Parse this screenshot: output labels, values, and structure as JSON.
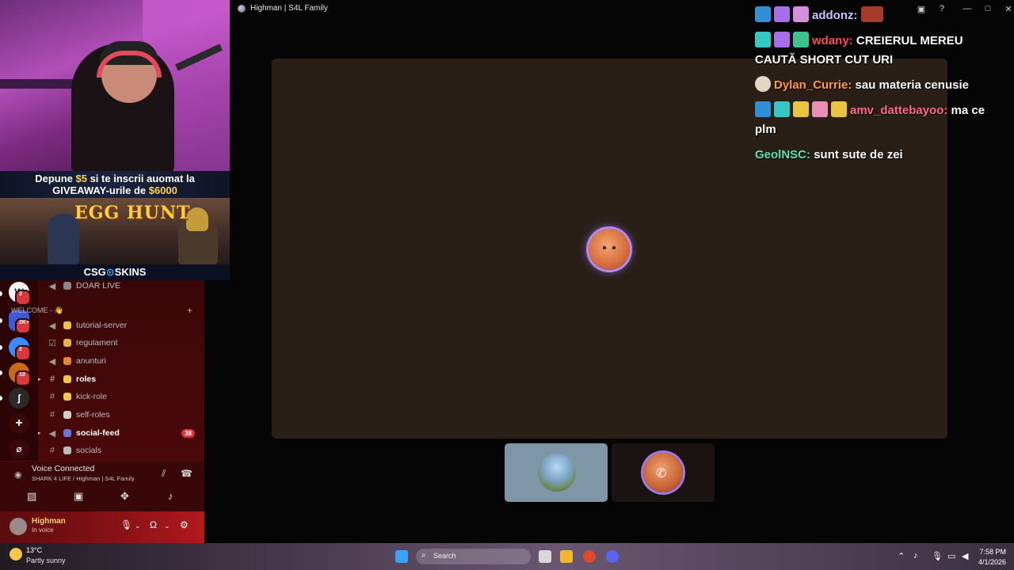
{
  "window": {
    "title": "Highman | S4L Family"
  },
  "overlay": {
    "promo_prefix": "Depune ",
    "promo_amount": "$5",
    "promo_suffix": " si te inscrii auomat la",
    "promo_line2_prefix": "GIVEAWAY-urile de ",
    "promo_line2_amount": "$6000",
    "banner_title": "EGG HUNT",
    "brand_left": "CSG",
    "brand_mid": "⊙",
    "brand_right": "SKINS"
  },
  "sidebar": {
    "servers": [
      {
        "letter": "W",
        "badge": "2",
        "color": "#ffffff"
      },
      {
        "letter": "",
        "badge": "2K+",
        "color": "#3b5bdb"
      },
      {
        "letter": "",
        "badge": "2",
        "color": "#3a8bff"
      },
      {
        "letter": "",
        "badge": "10",
        "color": "#c96a1b"
      },
      {
        "letter": "ʃ",
        "badge": "",
        "color": "#2a2a2a"
      },
      {
        "letter": "+",
        "badge": "",
        "color": "#3a0708"
      },
      {
        "letter": "⌀",
        "badge": "",
        "color": "#3a0708"
      }
    ],
    "category": "WELCOME - 👋",
    "channels": [
      {
        "name": "DOAR LIVE",
        "emoji_color": "#888",
        "bold": false,
        "count": ""
      },
      {
        "name": "tutorial-server",
        "emoji_color": "#f0c24b",
        "bold": false,
        "count": ""
      },
      {
        "name": "regulament",
        "emoji_color": "#e9b44c",
        "bold": false,
        "count": ""
      },
      {
        "name": "anunturi",
        "emoji_color": "#e0883a",
        "bold": false,
        "count": ""
      },
      {
        "name": "roles",
        "emoji_color": "#f5c542",
        "bold": true,
        "count": ""
      },
      {
        "name": "kick-role",
        "emoji_color": "#f2c94c",
        "bold": false,
        "count": ""
      },
      {
        "name": "self-roles",
        "emoji_color": "#cfcfcf",
        "bold": false,
        "count": ""
      },
      {
        "name": "social-feed",
        "emoji_color": "#6d73d8",
        "bold": true,
        "count": "38"
      },
      {
        "name": "socials",
        "emoji_color": "#b9bbbe",
        "bold": false,
        "count": ""
      }
    ]
  },
  "voice": {
    "status": "Voice Connected",
    "channel": "SHARK 4 LIFE / Highman | S4L Family"
  },
  "user": {
    "name": "Highman",
    "status": "In voice"
  },
  "chat": [
    {
      "user": "addonz:",
      "text": ""
    },
    {
      "user": "wdany:",
      "text": "CREIERUL MEREU CAUTĂ SHORT CUT URI"
    },
    {
      "user": "Dylan_Currie:",
      "text": "sau materia cenusie"
    },
    {
      "user": "amv_dattebayoo:",
      "text": "ma ce plm"
    },
    {
      "user": "GeolNSC:",
      "text": "sunt sute de zei"
    }
  ],
  "taskbar": {
    "temp": "13°C",
    "condition": "Partly sunny",
    "search_placeholder": "Search",
    "time": "7:58 PM",
    "date": "4/1/2026"
  }
}
